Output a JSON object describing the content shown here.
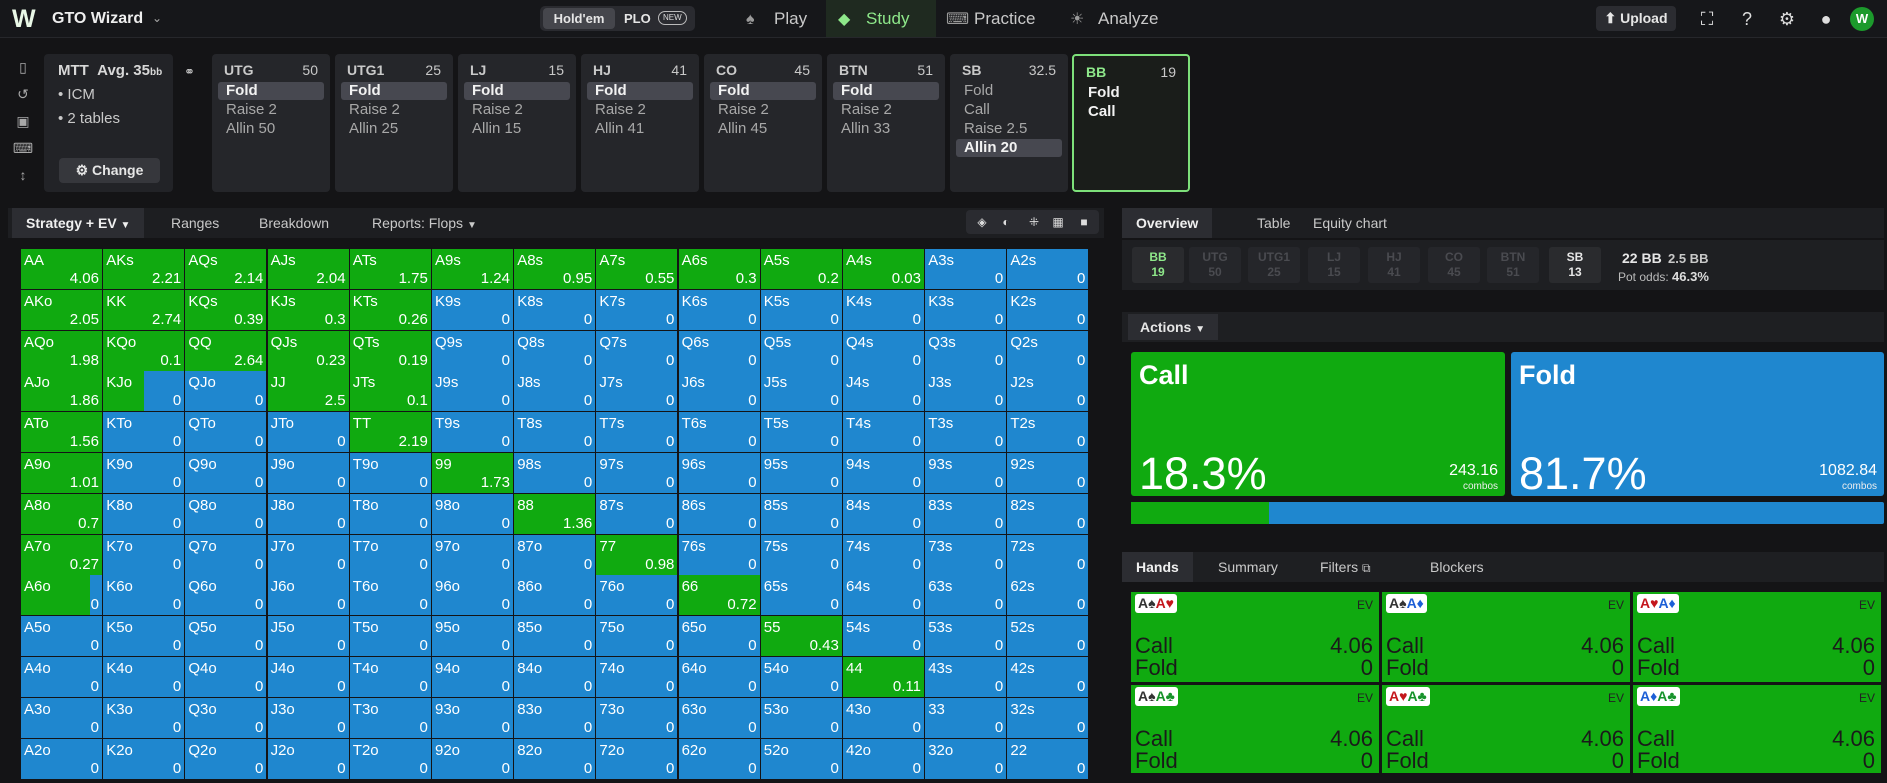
{
  "app": {
    "name": "GTO Wizard"
  },
  "gametoggle": {
    "holdem": "Hold'em",
    "plo": "PLO",
    "new_badge": "NEW"
  },
  "nav": [
    {
      "label": "Play",
      "icon": "spade-icon"
    },
    {
      "label": "Study",
      "icon": "graduation-cap-icon"
    },
    {
      "label": "Practice",
      "icon": "gamepad-icon"
    },
    {
      "label": "Analyze",
      "icon": "lightbulb-icon"
    }
  ],
  "toolbar": {
    "upload": "Upload"
  },
  "info": {
    "format": "MTT",
    "avg": "Avg. 35",
    "avg_unit": "bb",
    "line1": "• ICM",
    "line2": "• 2 tables",
    "change": "Change"
  },
  "positions": [
    {
      "name": "UTG",
      "stack": "50",
      "actions": [
        "Fold",
        "Raise 2",
        "Allin 50"
      ],
      "selected": 0
    },
    {
      "name": "UTG1",
      "stack": "25",
      "actions": [
        "Fold",
        "Raise 2",
        "Allin 25"
      ],
      "selected": 0
    },
    {
      "name": "LJ",
      "stack": "15",
      "actions": [
        "Fold",
        "Raise 2",
        "Allin 15"
      ],
      "selected": 0
    },
    {
      "name": "HJ",
      "stack": "41",
      "actions": [
        "Fold",
        "Raise 2",
        "Allin 41"
      ],
      "selected": 0
    },
    {
      "name": "CO",
      "stack": "45",
      "actions": [
        "Fold",
        "Raise 2",
        "Allin 45"
      ],
      "selected": 0
    },
    {
      "name": "BTN",
      "stack": "51",
      "actions": [
        "Fold",
        "Raise 2",
        "Allin 33"
      ],
      "selected": 0
    },
    {
      "name": "SB",
      "stack": "32.5",
      "actions": [
        "Fold",
        "Call",
        "Raise 2.5",
        "Allin 20"
      ],
      "selected": 3
    },
    {
      "name": "BB",
      "stack": "19",
      "actions": [
        "Fold",
        "Call"
      ],
      "selected": -1
    }
  ],
  "lefttabs": {
    "strategy": "Strategy + EV",
    "ranges": "Ranges",
    "breakdown": "Breakdown",
    "reports": "Reports: Flops"
  },
  "righttabs": {
    "overview": "Overview",
    "table": "Table",
    "equity": "Equity chart"
  },
  "seats": [
    {
      "name": "BB",
      "stack": "19"
    },
    {
      "name": "UTG",
      "stack": "50"
    },
    {
      "name": "UTG1",
      "stack": "25"
    },
    {
      "name": "LJ",
      "stack": "15"
    },
    {
      "name": "HJ",
      "stack": "41"
    },
    {
      "name": "CO",
      "stack": "45"
    },
    {
      "name": "BTN",
      "stack": "51"
    },
    {
      "name": "SB",
      "stack": "13"
    }
  ],
  "pot": {
    "main": "22 BB",
    "extra": "2.5 BB",
    "odds_label": "Pot odds:",
    "odds": "46.3%"
  },
  "actions_label": "Actions",
  "summary": {
    "call": {
      "label": "Call",
      "pct": "18.3%",
      "combos": "243.16",
      "combos_label": "combos",
      "fraction": 0.183
    },
    "fold": {
      "label": "Fold",
      "pct": "81.7%",
      "combos": "1082.84",
      "combos_label": "combos",
      "fraction": 0.817
    }
  },
  "handtabs": {
    "hands": "Hands",
    "summary": "Summary",
    "filters": "Filters",
    "blockers": "Blockers"
  },
  "hands": [
    {
      "c1": "A♠",
      "c2": "A♥",
      "ev": "EV",
      "call": "Call",
      "call_v": "4.06",
      "fold": "Fold",
      "fold_v": "0"
    },
    {
      "c1": "A♠",
      "c2": "A♦",
      "ev": "EV",
      "call": "Call",
      "call_v": "4.06",
      "fold": "Fold",
      "fold_v": "0"
    },
    {
      "c1": "A♥",
      "c2": "A♦",
      "ev": "EV",
      "call": "Call",
      "call_v": "4.06",
      "fold": "Fold",
      "fold_v": "0"
    },
    {
      "c1": "A♠",
      "c2": "A♣",
      "ev": "EV",
      "call": "Call",
      "call_v": "4.06",
      "fold": "Fold",
      "fold_v": "0"
    },
    {
      "c1": "A♥",
      "c2": "A♣",
      "ev": "EV",
      "call": "Call",
      "call_v": "4.06",
      "fold": "Fold",
      "fold_v": "0"
    },
    {
      "c1": "A♦",
      "c2": "A♣",
      "ev": "EV",
      "call": "Call",
      "call_v": "4.06",
      "fold": "Fold",
      "fold_v": "0"
    }
  ],
  "colors": {
    "call": "#10aa10",
    "fold": "#1f87cf",
    "accent": "#8ee88a"
  },
  "matrix": [
    [
      [
        "AA",
        "4.06",
        1
      ],
      [
        "AKs",
        "2.21",
        1
      ],
      [
        "AQs",
        "2.14",
        1
      ],
      [
        "AJs",
        "2.04",
        1
      ],
      [
        "ATs",
        "1.75",
        1
      ],
      [
        "A9s",
        "1.24",
        1
      ],
      [
        "A8s",
        "0.95",
        1
      ],
      [
        "A7s",
        "0.55",
        1
      ],
      [
        "A6s",
        "0.3",
        1
      ],
      [
        "A5s",
        "0.2",
        1
      ],
      [
        "A4s",
        "0.03",
        1
      ],
      [
        "A3s",
        "0",
        0
      ],
      [
        "A2s",
        "0",
        0
      ]
    ],
    [
      [
        "AKo",
        "2.05",
        1
      ],
      [
        "KK",
        "2.74",
        1
      ],
      [
        "KQs",
        "0.39",
        1
      ],
      [
        "KJs",
        "0.3",
        1
      ],
      [
        "KTs",
        "0.26",
        1
      ],
      [
        "K9s",
        "0",
        0
      ],
      [
        "K8s",
        "0",
        0
      ],
      [
        "K7s",
        "0",
        0
      ],
      [
        "K6s",
        "0",
        0
      ],
      [
        "K5s",
        "0",
        0
      ],
      [
        "K4s",
        "0",
        0
      ],
      [
        "K3s",
        "0",
        0
      ],
      [
        "K2s",
        "0",
        0
      ]
    ],
    [
      [
        "AQo",
        "1.98",
        1
      ],
      [
        "KQo",
        "0.1",
        1
      ],
      [
        "QQ",
        "2.64",
        1
      ],
      [
        "QJs",
        "0.23",
        1
      ],
      [
        "QTs",
        "0.19",
        1
      ],
      [
        "Q9s",
        "0",
        0
      ],
      [
        "Q8s",
        "0",
        0
      ],
      [
        "Q7s",
        "0",
        0
      ],
      [
        "Q6s",
        "0",
        0
      ],
      [
        "Q5s",
        "0",
        0
      ],
      [
        "Q4s",
        "0",
        0
      ],
      [
        "Q3s",
        "0",
        0
      ],
      [
        "Q2s",
        "0",
        0
      ]
    ],
    [
      [
        "AJo",
        "1.86",
        1
      ],
      [
        "KJo",
        "0",
        0.5
      ],
      [
        "QJo",
        "0",
        0
      ],
      [
        "JJ",
        "2.5",
        1
      ],
      [
        "JTs",
        "0.1",
        1
      ],
      [
        "J9s",
        "0",
        0
      ],
      [
        "J8s",
        "0",
        0
      ],
      [
        "J7s",
        "0",
        0
      ],
      [
        "J6s",
        "0",
        0
      ],
      [
        "J5s",
        "0",
        0
      ],
      [
        "J4s",
        "0",
        0
      ],
      [
        "J3s",
        "0",
        0
      ],
      [
        "J2s",
        "0",
        0
      ]
    ],
    [
      [
        "ATo",
        "1.56",
        1
      ],
      [
        "KTo",
        "0",
        0
      ],
      [
        "QTo",
        "0",
        0
      ],
      [
        "JTo",
        "0",
        0
      ],
      [
        "TT",
        "2.19",
        1
      ],
      [
        "T9s",
        "0",
        0
      ],
      [
        "T8s",
        "0",
        0
      ],
      [
        "T7s",
        "0",
        0
      ],
      [
        "T6s",
        "0",
        0
      ],
      [
        "T5s",
        "0",
        0
      ],
      [
        "T4s",
        "0",
        0
      ],
      [
        "T3s",
        "0",
        0
      ],
      [
        "T2s",
        "0",
        0
      ]
    ],
    [
      [
        "A9o",
        "1.01",
        1
      ],
      [
        "K9o",
        "0",
        0
      ],
      [
        "Q9o",
        "0",
        0
      ],
      [
        "J9o",
        "0",
        0
      ],
      [
        "T9o",
        "0",
        0
      ],
      [
        "99",
        "1.73",
        1
      ],
      [
        "98s",
        "0",
        0
      ],
      [
        "97s",
        "0",
        0
      ],
      [
        "96s",
        "0",
        0
      ],
      [
        "95s",
        "0",
        0
      ],
      [
        "94s",
        "0",
        0
      ],
      [
        "93s",
        "0",
        0
      ],
      [
        "92s",
        "0",
        0
      ]
    ],
    [
      [
        "A8o",
        "0.7",
        1
      ],
      [
        "K8o",
        "0",
        0
      ],
      [
        "Q8o",
        "0",
        0
      ],
      [
        "J8o",
        "0",
        0
      ],
      [
        "T8o",
        "0",
        0
      ],
      [
        "98o",
        "0",
        0
      ],
      [
        "88",
        "1.36",
        1
      ],
      [
        "87s",
        "0",
        0
      ],
      [
        "86s",
        "0",
        0
      ],
      [
        "85s",
        "0",
        0
      ],
      [
        "84s",
        "0",
        0
      ],
      [
        "83s",
        "0",
        0
      ],
      [
        "82s",
        "0",
        0
      ]
    ],
    [
      [
        "A7o",
        "0.27",
        1
      ],
      [
        "K7o",
        "0",
        0
      ],
      [
        "Q7o",
        "0",
        0
      ],
      [
        "J7o",
        "0",
        0
      ],
      [
        "T7o",
        "0",
        0
      ],
      [
        "97o",
        "0",
        0
      ],
      [
        "87o",
        "0",
        0
      ],
      [
        "77",
        "0.98",
        1
      ],
      [
        "76s",
        "0",
        0
      ],
      [
        "75s",
        "0",
        0
      ],
      [
        "74s",
        "0",
        0
      ],
      [
        "73s",
        "0",
        0
      ],
      [
        "72s",
        "0",
        0
      ]
    ],
    [
      [
        "A6o",
        "0",
        0.85
      ],
      [
        "K6o",
        "0",
        0
      ],
      [
        "Q6o",
        "0",
        0
      ],
      [
        "J6o",
        "0",
        0
      ],
      [
        "T6o",
        "0",
        0
      ],
      [
        "96o",
        "0",
        0
      ],
      [
        "86o",
        "0",
        0
      ],
      [
        "76o",
        "0",
        0
      ],
      [
        "66",
        "0.72",
        1
      ],
      [
        "65s",
        "0",
        0
      ],
      [
        "64s",
        "0",
        0
      ],
      [
        "63s",
        "0",
        0
      ],
      [
        "62s",
        "0",
        0
      ]
    ],
    [
      [
        "A5o",
        "0",
        0
      ],
      [
        "K5o",
        "0",
        0
      ],
      [
        "Q5o",
        "0",
        0
      ],
      [
        "J5o",
        "0",
        0
      ],
      [
        "T5o",
        "0",
        0
      ],
      [
        "95o",
        "0",
        0
      ],
      [
        "85o",
        "0",
        0
      ],
      [
        "75o",
        "0",
        0
      ],
      [
        "65o",
        "0",
        0
      ],
      [
        "55",
        "0.43",
        1
      ],
      [
        "54s",
        "0",
        0
      ],
      [
        "53s",
        "0",
        0
      ],
      [
        "52s",
        "0",
        0
      ]
    ],
    [
      [
        "A4o",
        "0",
        0
      ],
      [
        "K4o",
        "0",
        0
      ],
      [
        "Q4o",
        "0",
        0
      ],
      [
        "J4o",
        "0",
        0
      ],
      [
        "T4o",
        "0",
        0
      ],
      [
        "94o",
        "0",
        0
      ],
      [
        "84o",
        "0",
        0
      ],
      [
        "74o",
        "0",
        0
      ],
      [
        "64o",
        "0",
        0
      ],
      [
        "54o",
        "0",
        0
      ],
      [
        "44",
        "0.11",
        1
      ],
      [
        "43s",
        "0",
        0
      ],
      [
        "42s",
        "0",
        0
      ]
    ],
    [
      [
        "A3o",
        "0",
        0
      ],
      [
        "K3o",
        "0",
        0
      ],
      [
        "Q3o",
        "0",
        0
      ],
      [
        "J3o",
        "0",
        0
      ],
      [
        "T3o",
        "0",
        0
      ],
      [
        "93o",
        "0",
        0
      ],
      [
        "83o",
        "0",
        0
      ],
      [
        "73o",
        "0",
        0
      ],
      [
        "63o",
        "0",
        0
      ],
      [
        "53o",
        "0",
        0
      ],
      [
        "43o",
        "0",
        0
      ],
      [
        "33",
        "0",
        0
      ],
      [
        "32s",
        "0",
        0
      ]
    ],
    [
      [
        "A2o",
        "0",
        0
      ],
      [
        "K2o",
        "0",
        0
      ],
      [
        "Q2o",
        "0",
        0
      ],
      [
        "J2o",
        "0",
        0
      ],
      [
        "T2o",
        "0",
        0
      ],
      [
        "92o",
        "0",
        0
      ],
      [
        "82o",
        "0",
        0
      ],
      [
        "72o",
        "0",
        0
      ],
      [
        "62o",
        "0",
        0
      ],
      [
        "52o",
        "0",
        0
      ],
      [
        "42o",
        "0",
        0
      ],
      [
        "32o",
        "0",
        0
      ],
      [
        "22",
        "0",
        0
      ]
    ]
  ]
}
